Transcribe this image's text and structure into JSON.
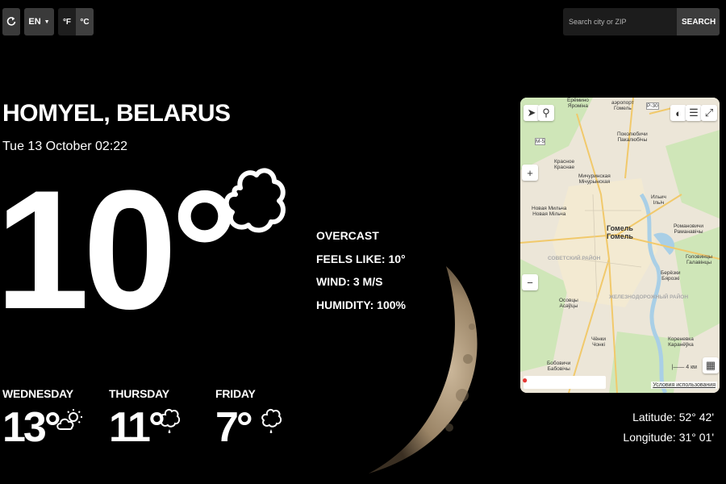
{
  "toolbar": {
    "refresh_icon": "refresh-icon",
    "language": "EN",
    "unit_f": "°F",
    "unit_c": "°C",
    "active_unit": "C"
  },
  "search": {
    "placeholder": "Search city or ZIP",
    "button_label": "SEARCH"
  },
  "current": {
    "location": "HOMYEL, BELARUS",
    "datetime": "Tue 13 October 02:22",
    "temperature": "10°",
    "icon": "cloud-icon",
    "condition": "OVERCAST",
    "feels_like": "FEELS LIKE: 10°",
    "wind": "WIND: 3 M/S",
    "humidity": "HUMIDITY: 100%"
  },
  "forecast": [
    {
      "day": "WEDNESDAY",
      "temp": "13°",
      "icon": "partly-cloudy-sun-icon"
    },
    {
      "day": "THURSDAY",
      "temp": "11°",
      "icon": "cloud-rain-icon"
    },
    {
      "day": "FRIDAY",
      "temp": "7°",
      "icon": "cloud-rain-icon"
    }
  ],
  "map": {
    "city_label": "Гомель",
    "city_label_2": "Гомель",
    "places": [
      {
        "name": "Ерёмино",
        "alt": "Яромiна"
      },
      {
        "name": "аэропорт",
        "alt": "Гомель"
      },
      {
        "name": "Поколюбичи",
        "alt": "Пакалюбiчы"
      },
      {
        "name": "Красное",
        "alt": "Краснае"
      },
      {
        "name": "Мичуринская",
        "alt": "Мiчурынская"
      },
      {
        "name": "Ильич",
        "alt": "Iльiч"
      },
      {
        "name": "Новая Мильча",
        "alt": "Новая Мiльча"
      },
      {
        "name": "Романовичи",
        "alt": "Раманавiчы"
      },
      {
        "name": "Головинцы",
        "alt": "Галавiнцы"
      },
      {
        "name": "Берёзки",
        "alt": "Бярозкi"
      },
      {
        "name": "Осовцы",
        "alt": "Асаўцы"
      },
      {
        "name": "Чёнки",
        "alt": "Чонкi"
      },
      {
        "name": "Кореневка",
        "alt": "Каранёўка"
      },
      {
        "name": "Бобовичи",
        "alt": "Бабовiчы"
      }
    ],
    "districts": [
      "СОВЕТСКИЙ РАЙОН",
      "ЖЕЛЕЗНОДОРОЖНЫЙ РАЙОН"
    ],
    "scale": "4 км",
    "terms": "Условия использования",
    "road_m5": "М-5",
    "road_r30": "Р-30"
  },
  "coordinates": {
    "latitude": "Latitude: 52° 42'",
    "longitude": "Longitude: 31° 01'"
  }
}
